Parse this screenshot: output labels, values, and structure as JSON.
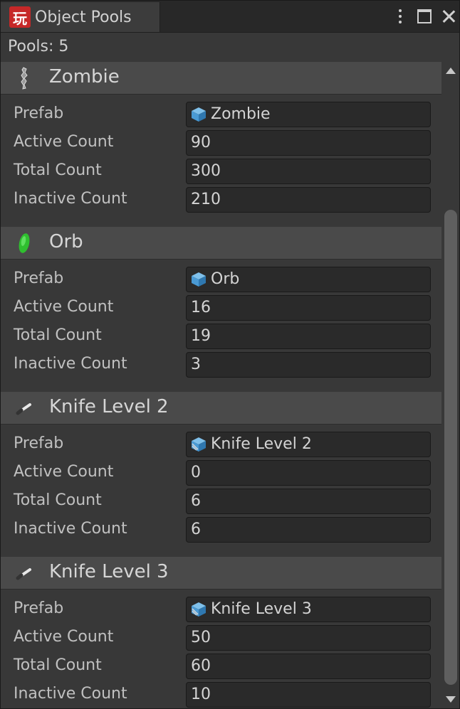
{
  "window": {
    "tab_title": "Object Pools",
    "tab_icon_glyph": "玩",
    "tab_icon_color": "#c62828",
    "controls": [
      "more-options-icon",
      "maximize-icon",
      "close-icon"
    ]
  },
  "pool_count_label": "Pools: 5",
  "labels": {
    "prefab": "Prefab",
    "active": "Active Count",
    "total": "Total Count",
    "inactive": "Inactive Count"
  },
  "pools": [
    {
      "name": "Zombie",
      "icon": "zombie-sprite-icon",
      "prefab": "Zombie",
      "prefab_icon": "prefab-cube-icon",
      "active": "90",
      "total": "300",
      "inactive": "210"
    },
    {
      "name": "Orb",
      "icon": "orb-sprite-icon",
      "prefab": "Orb",
      "prefab_icon": "prefab-cube-icon",
      "active": "16",
      "total": "19",
      "inactive": "3"
    },
    {
      "name": "Knife Level 2",
      "icon": "knife-sprite-icon",
      "prefab": "Knife Level 2",
      "prefab_icon": "prefab-variant-cube-icon",
      "active": "0",
      "total": "6",
      "inactive": "6"
    },
    {
      "name": "Knife Level 3",
      "icon": "knife-sprite-icon",
      "prefab": "Knife Level 3",
      "prefab_icon": "prefab-variant-cube-icon",
      "active": "50",
      "total": "60",
      "inactive": "10"
    }
  ]
}
